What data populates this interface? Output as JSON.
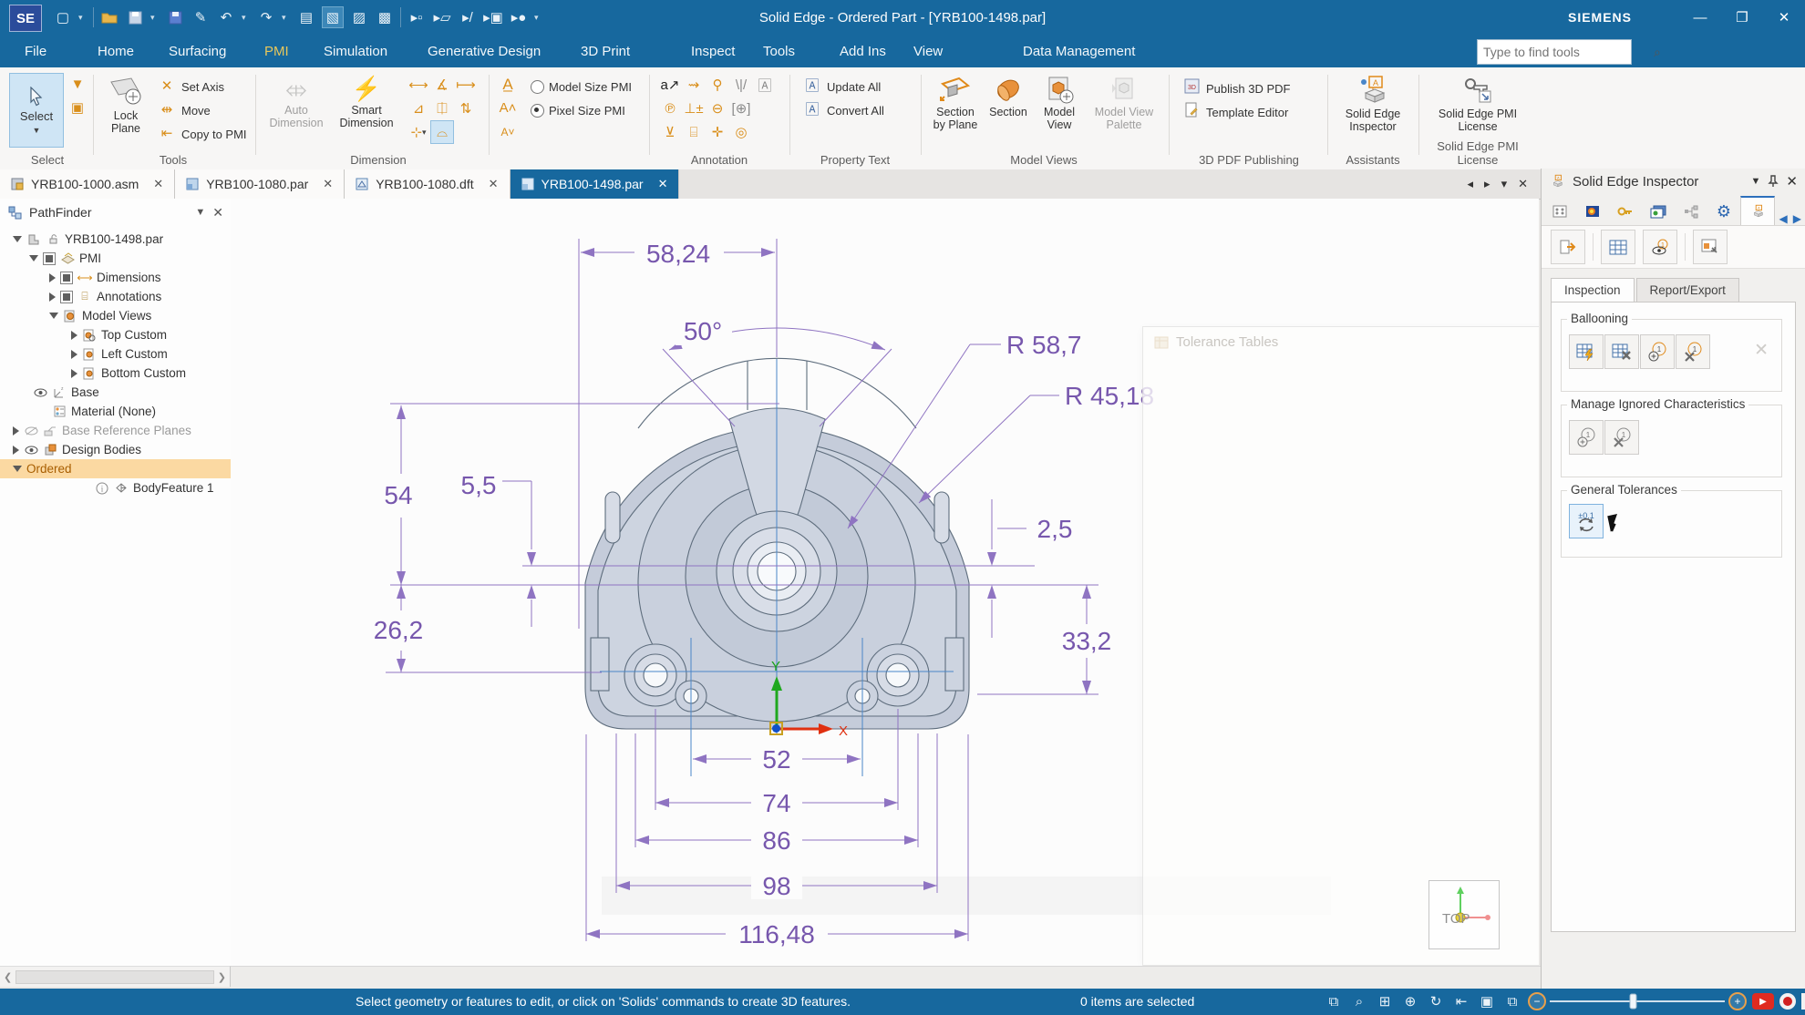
{
  "window": {
    "logo": "SE",
    "title": "Solid Edge - Ordered Part - [YRB100-1498.par]",
    "brand": "SIEMENS"
  },
  "search": {
    "placeholder": "Type to find tools"
  },
  "ribbon": {
    "tabs": [
      "File",
      "Home",
      "Surfacing",
      "PMI",
      "Simulation",
      "Generative Design",
      "3D Print",
      "Inspect",
      "Tools",
      "Add Ins",
      "View",
      "Data Management"
    ],
    "active_tab": "PMI",
    "select_group": {
      "label": "Select",
      "select": "Select"
    },
    "tools_group": {
      "label": "Tools",
      "lock_plane": "Lock Plane",
      "set_axis": "Set Axis",
      "move": "Move",
      "copy_to_pmi": "Copy to PMI"
    },
    "dimension_group": {
      "label": "Dimension",
      "auto": "Auto Dimension",
      "smart": "Smart Dimension"
    },
    "pmi_size": {
      "model": "Model Size PMI",
      "pixel": "Pixel Size PMI"
    },
    "annotation_group": {
      "label": "Annotation"
    },
    "property_group": {
      "label": "Property Text",
      "update": "Update All",
      "convert": "Convert All"
    },
    "model_views_group": {
      "label": "Model Views",
      "section_by_plane": "Section by Plane",
      "section": "Section",
      "model_view": "Model View",
      "palette": "Model View Palette"
    },
    "pdf_group": {
      "label": "3D PDF Publishing",
      "publish": "Publish 3D PDF",
      "template": "Template Editor"
    },
    "assistants_group": {
      "label": "Assistants",
      "inspector": "Solid Edge Inspector"
    },
    "license_group": {
      "label": "Solid Edge PMI License",
      "license": "Solid Edge PMI License"
    }
  },
  "doc_tabs": [
    {
      "label": "YRB100-1000.asm"
    },
    {
      "label": "YRB100-1080.par"
    },
    {
      "label": "YRB100-1080.dft"
    },
    {
      "label": "YRB100-1498.par"
    }
  ],
  "pathfinder": {
    "title": "PathFinder",
    "items": [
      {
        "label": "YRB100-1498.par"
      },
      {
        "label": "PMI"
      },
      {
        "label": "Dimensions"
      },
      {
        "label": "Annotations"
      },
      {
        "label": "Model Views"
      },
      {
        "label": "Top Custom"
      },
      {
        "label": "Left Custom"
      },
      {
        "label": "Bottom Custom"
      },
      {
        "label": "Base"
      },
      {
        "label": "Material (None)"
      },
      {
        "label": "Base Reference Planes"
      },
      {
        "label": "Design Bodies"
      },
      {
        "label": "Ordered"
      },
      {
        "label": "BodyFeature 1"
      }
    ]
  },
  "drawing": {
    "dims": {
      "w5824": "58,24",
      "angle50": "50°",
      "r587": "R 58,7",
      "r4518": "R 45,18",
      "h54": "54",
      "g55": "5,5",
      "g25": "2,5",
      "h262": "26,2",
      "h332": "33,2",
      "w52": "52",
      "w74": "74",
      "w86": "86",
      "w98": "98",
      "w11648": "116,48"
    },
    "axis": {
      "x": "X",
      "y": "Y"
    },
    "view_indicator": "TOP",
    "ghost_window_title": "Tolerance Tables"
  },
  "inspector": {
    "title": "Solid Edge Inspector",
    "tabs": [
      "Inspection",
      "Report/Export"
    ],
    "sections": {
      "ballooning": "Ballooning",
      "manage": "Manage Ignored Characteristics",
      "general": "General Tolerances",
      "tolerance_value": "±0.1"
    }
  },
  "status": {
    "hint": "Select geometry or features to edit, or click on 'Solids' commands to create 3D features.",
    "selection": "0 items are selected"
  },
  "colors": {
    "titlebar_blue": "#17689E",
    "accent_orange": "#E08A1A",
    "dimension_purple": "#7757AD",
    "selection_highlight": "#FBD9A2",
    "active_tab_gold": "#E8C75B"
  }
}
